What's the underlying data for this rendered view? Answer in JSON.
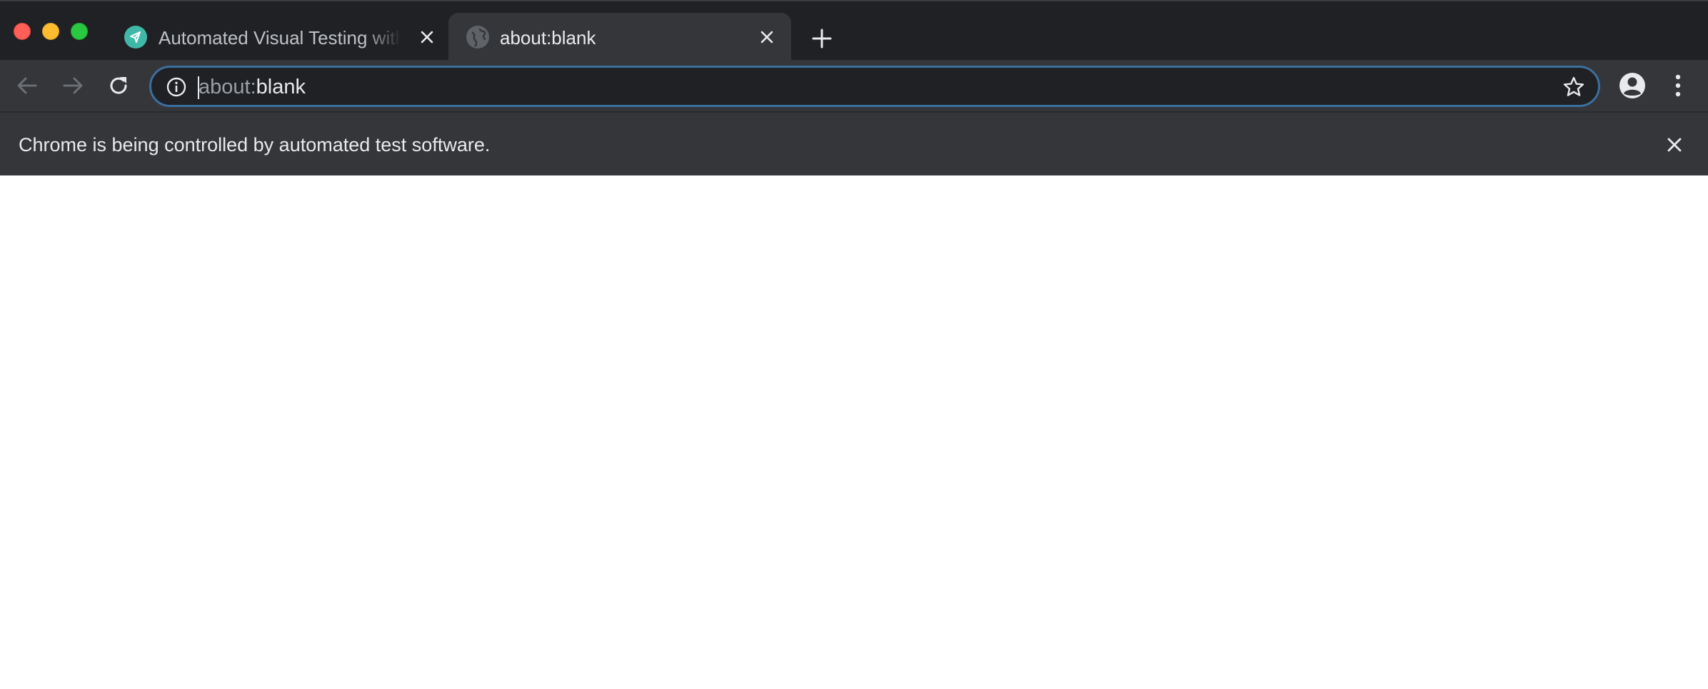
{
  "window": {
    "controls": [
      "close",
      "minimize",
      "zoom"
    ]
  },
  "tabs": [
    {
      "title": "Automated Visual Testing with",
      "favicon": "paper-plane-icon",
      "active": false
    },
    {
      "title": "about:blank",
      "favicon": "globe-icon",
      "active": true
    }
  ],
  "toolbar": {
    "address": {
      "scheme": "about:",
      "host": "blank"
    }
  },
  "infobar": {
    "message": "Chrome is being controlled by automated test software."
  },
  "colors": {
    "tabstrip": "#202124",
    "toolbar": "#35363a",
    "omnibox_focus": "#3b6f9e",
    "favicon_accent": "#3fb8a8",
    "text": "#e8eaed",
    "muted_text": "#9aa0a6"
  }
}
